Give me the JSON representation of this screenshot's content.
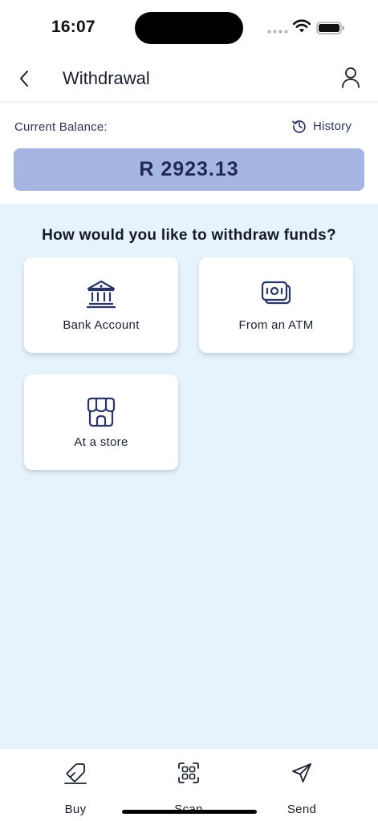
{
  "status_bar": {
    "time": "16:07",
    "icons": [
      "cellular-dots-icon",
      "wifi-icon",
      "battery-icon"
    ]
  },
  "header": {
    "title": "Withdrawal",
    "back_icon": "chevron-left-icon",
    "profile_icon": "user-icon"
  },
  "balance": {
    "label": "Current Balance:",
    "amount": "R 2923.13",
    "history_label": "History",
    "history_icon": "history-clock-icon"
  },
  "withdraw": {
    "question": "How would you like to withdraw funds?",
    "options": [
      {
        "label": "Bank Account",
        "icon": "bank-icon"
      },
      {
        "label": "From an ATM",
        "icon": "cash-notes-icon"
      },
      {
        "label": "At a store",
        "icon": "storefront-icon"
      }
    ]
  },
  "bottom_nav": {
    "items": [
      {
        "label": "Buy",
        "icon": "tag-icon"
      },
      {
        "label": "Scan",
        "icon": "qr-scan-icon"
      },
      {
        "label": "Send",
        "icon": "paper-plane-icon"
      }
    ]
  },
  "colors": {
    "primary_navy": "#2c3560",
    "balance_bg": "#a6b6e2",
    "content_bg": "#e6f3fc",
    "card_bg": "#ffffff"
  }
}
